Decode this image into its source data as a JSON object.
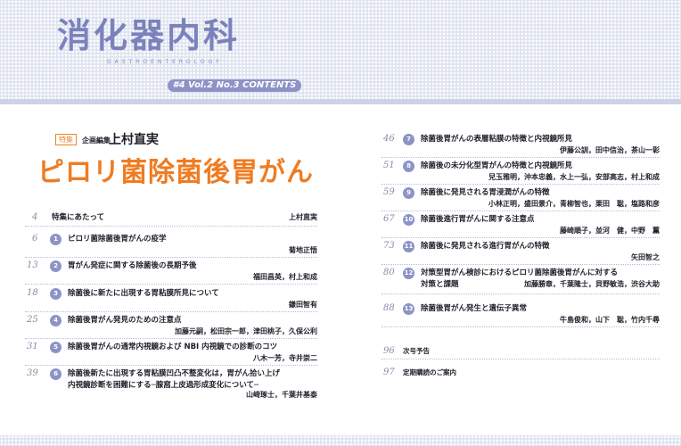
{
  "header": {
    "journal_title": "消化器内科",
    "journal_subtitle": "GASTROENTEROLOGY",
    "contents_bar": "#4   Vol.2 No.3   CONTENTS"
  },
  "feature": {
    "badge": "特集",
    "editor_label": "企画編集",
    "editor_name": "上村直実",
    "title": "ピロリ菌除菌後胃がん"
  },
  "left_entries": [
    {
      "page": "4",
      "number": "",
      "title": "特集にあたって",
      "title2": "",
      "authors": "上村直実"
    },
    {
      "page": "6",
      "number": "1",
      "title": "ピロリ菌除菌後胃がんの疫学",
      "title2": "",
      "authors": "菊地正悟"
    },
    {
      "page": "13",
      "number": "2",
      "title": "胃がん発症に関する除菌後の長期予後",
      "title2": "",
      "authors": "福田昌英，村上和成"
    },
    {
      "page": "18",
      "number": "3",
      "title": "除菌後に新たに出現する胃粘膜所見について",
      "title2": "",
      "authors": "鎌田智有"
    },
    {
      "page": "25",
      "number": "4",
      "title": "除菌後胃がん発見のための注意点",
      "title2": "",
      "authors": "加藤元嗣，松田宗一郎，津田桃子，久保公利"
    },
    {
      "page": "31",
      "number": "5",
      "title": "除菌後胃がんの通常内視鏡および NBI 内視鏡での診断のコツ",
      "title2": "",
      "authors": "八木一芳，寺井崇二"
    },
    {
      "page": "39",
      "number": "6",
      "title": "除菌後新たに出現する胃粘膜凹凸不整変化は，胃がん拾い上げ",
      "title2": "内視鏡診断を困難にする─腺窩上皮過形成変化について─",
      "authors": "山﨑琢士，千葉井基泰"
    }
  ],
  "right_entries": [
    {
      "page": "46",
      "number": "7",
      "title": "除菌後胃がんの表層粘膜の特徴と内視鏡所見",
      "title2": "",
      "authors": "伊藤公訓，田中信治，茶山一彰"
    },
    {
      "page": "51",
      "number": "8",
      "title": "除菌後の未分化型胃がんの特徴と内視鏡所見",
      "title2": "",
      "authors": "兒玉雅明，沖本忠義，水上一弘，安部高志，村上和成"
    },
    {
      "page": "59",
      "number": "9",
      "title": "除菌後に発見される胃浸潤がんの特徴",
      "title2": "",
      "authors": "小林正明，盛田景介，青柳智也，栗田　聡，塩路和彦"
    },
    {
      "page": "67",
      "number": "10",
      "title": "除菌後進行胃がんに関する注意点",
      "title2": "",
      "authors": "藤崎順子，並河　健，中野　薫"
    },
    {
      "page": "73",
      "number": "11",
      "title": "除菌後に発見される進行胃がんの特徴",
      "title2": "",
      "authors": "矢田智之"
    },
    {
      "page": "80",
      "number": "12",
      "title": "対策型胃がん検診におけるピロリ菌除菌後胃がんに対する",
      "title2": "対策と課題",
      "authors": "加藤勝章，千葉隆士，貝野敏浩，渋谷大助"
    },
    {
      "page": "88",
      "number": "13",
      "title": "除菌後胃がん発生と遺伝子異常",
      "title2": "",
      "authors": "牛島俊和，山下　聡，竹内千尋"
    },
    {
      "page": "96",
      "number": "",
      "title": "次号予告",
      "title2": "",
      "authors": ""
    },
    {
      "page": "97",
      "number": "",
      "title": "定期購読のご案内",
      "title2": "",
      "authors": ""
    }
  ]
}
